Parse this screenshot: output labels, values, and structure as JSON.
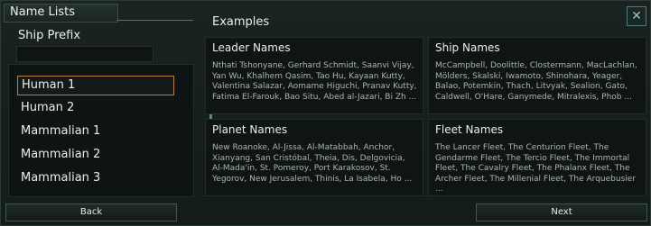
{
  "header": {
    "title": "Name Lists"
  },
  "left": {
    "ship_prefix_label": "Ship Prefix",
    "ship_prefix_value": "",
    "list_items": [
      "Human 1",
      "Human 2",
      "Mammalian 1",
      "Mammalian 2",
      "Mammalian 3"
    ],
    "selected_item": "Human 1"
  },
  "examples": {
    "title": "Examples",
    "cards": [
      {
        "title": "Leader Names",
        "body": "Nthati Tshonyane, Gerhard Schmidt, Saanvi Vijay, Yan Wu, Khalhem Qasim, Tao Hu, Kayaan Kutty, Valentina Salazar, Aomame Higuchi, Pranav Kutty, Fatima El-Farouk, Bao Situ, Abed al-Jazari, Bi Zh ..."
      },
      {
        "title": "Ship Names",
        "body": "McCampbell, Doolittle, Clostermann, MacLachlan, Mölders, Skalski, Iwamoto, Shinohara, Yeager, Balao, Potemkin, Thach, Litvyak, Sealion, Gato, Caldwell, O'Hare, Ganymede, Mitralexis, Phob ..."
      },
      {
        "title": "Planet Names",
        "body": "New Roanoke, Al-Jissa, Al-Matabbah, Anchor, Xianyang, San Cristóbal, Theia, Dis, Delgovicia, Al-Mada'in, St. Pomeroy, Port Karakosov, St. Yegorov, New Jerusalem, Thinis, La Isabela, Ho ..."
      },
      {
        "title": "Fleet Names",
        "body": "The Lancer Fleet, The Centurion Fleet, The Gendarme Fleet, The Tercio Fleet, The Immortal Fleet, The Cavalry Fleet, The Phalanx Fleet, The Archer Fleet, The Millenial Fleet, The Arquebusier ..."
      }
    ]
  },
  "footer": {
    "back_label": "Back",
    "next_label": "Next"
  },
  "icons": {
    "close": "close-icon"
  },
  "colors": {
    "selection_border": "#b9813a",
    "accent": "#5d8880"
  }
}
